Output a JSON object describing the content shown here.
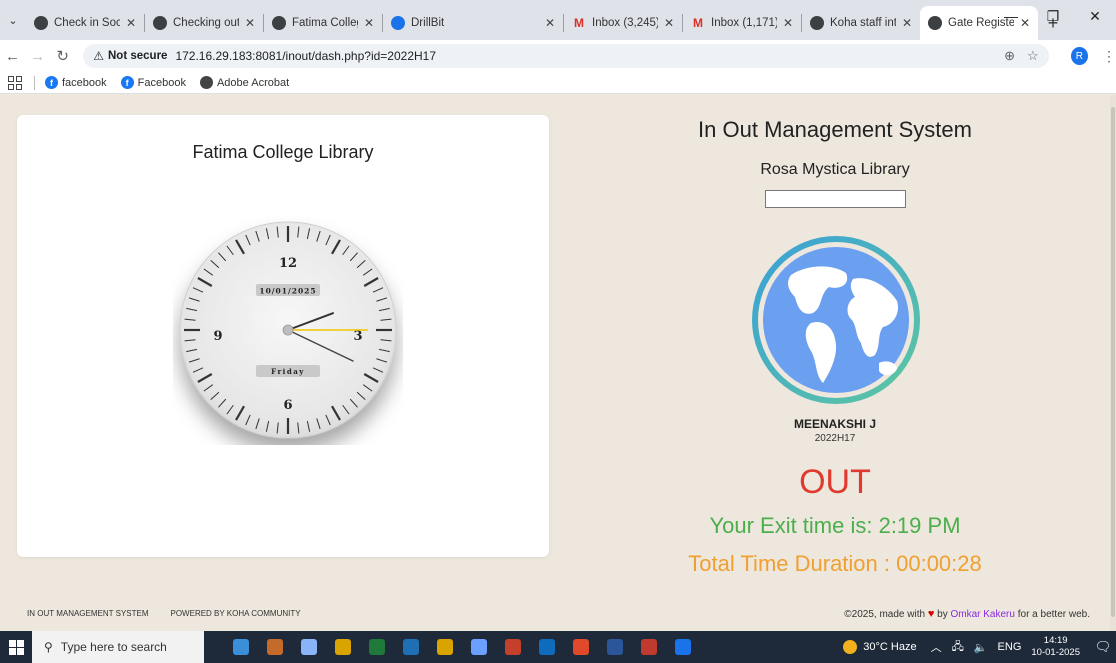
{
  "browser": {
    "tabs": [
      {
        "title": "Check in Socic",
        "icon": "globe-icon",
        "color": "#3c4043",
        "active": false
      },
      {
        "title": "Checking out",
        "icon": "globe-icon",
        "color": "#3c4043",
        "active": false
      },
      {
        "title": "Fatima College",
        "icon": "globe-icon",
        "color": "#3c4043",
        "active": false
      },
      {
        "title": "DrillBit",
        "icon": "drillbit-icon",
        "color": "#1a73e8",
        "active": false
      },
      {
        "title": "Inbox (3,245)",
        "icon": "gmail-icon",
        "color": "#d93025",
        "active": false
      },
      {
        "title": "Inbox (1,171)",
        "icon": "gmail-icon",
        "color": "#d93025",
        "active": false
      },
      {
        "title": "Koha staff inte",
        "icon": "globe-icon",
        "color": "#3c4043",
        "active": false
      },
      {
        "title": "Gate Register",
        "icon": "globe-icon",
        "color": "#3c4043",
        "active": true
      }
    ],
    "security_label": "Not secure",
    "url": "172.16.29.183:8081/inout/dash.php?id=2022H17",
    "profile_initial": "R",
    "bookmarks": [
      {
        "label": "facebook",
        "icon": "facebook-icon"
      },
      {
        "label": "Facebook",
        "icon": "facebook-icon"
      },
      {
        "label": "Adobe Acrobat",
        "icon": "globe-icon"
      }
    ]
  },
  "clock_panel": {
    "library_title": "Fatima College Library",
    "date_label": "10/01/2025",
    "day_label": "Friday",
    "numerals": [
      "12",
      "3",
      "6",
      "9"
    ],
    "time": {
      "hours": 2,
      "minutes": 19,
      "seconds": 15
    }
  },
  "status_panel": {
    "system_title": "In Out Management System",
    "library_name": "Rosa Mystica Library",
    "scan_value": "",
    "member_name": "MEENAKSHI J",
    "member_id": "2022H17",
    "status": "OUT",
    "exit_time": "Your Exit time is: 2:19 PM",
    "duration": "Total Time Duration : 00:00:28"
  },
  "footer": {
    "left_items": [
      "IN OUT MANAGEMENT SYSTEM",
      "POWERED BY KOHA COMMUNITY"
    ],
    "copyright_prefix": "©2025, made with",
    "copyright_by": "by",
    "author": "Omkar Kakeru",
    "copyright_suffix": "for a better web."
  },
  "taskbar": {
    "search_placeholder": "Type here to search",
    "apps": [
      "#3b8ed8",
      "#c46a2a",
      "#8ab4f8",
      "#d9a400",
      "#1f7a3a",
      "#1f6fb5",
      "#d9a400",
      "#6ba0ff",
      "#c4402a",
      "#0f6cbd",
      "#e04a2a",
      "#2b579a",
      "#c13a2f",
      "#1a73e8"
    ],
    "weather": "30°C  Haze",
    "language": "ENG",
    "time": "14:19",
    "date": "10-01-2025"
  }
}
